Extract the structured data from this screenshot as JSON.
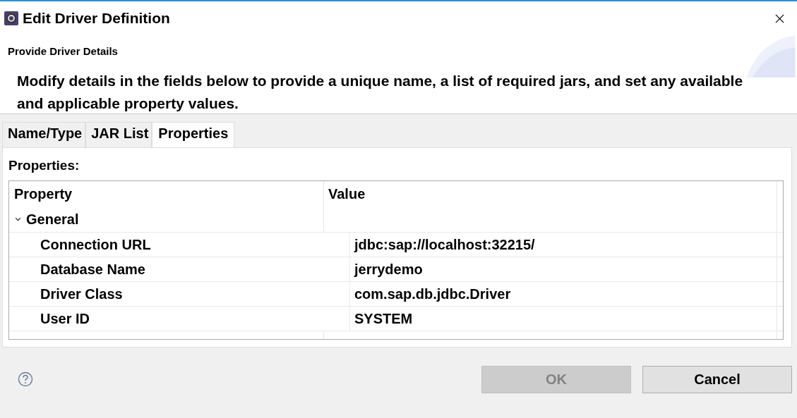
{
  "window": {
    "title": "Edit Driver Definition"
  },
  "header": {
    "title": "Provide Driver Details",
    "description": "Modify details in the fields below to provide a unique name, a list of required jars, and set any available and applicable property values."
  },
  "tabs": [
    {
      "label": "Name/Type",
      "selected": false
    },
    {
      "label": "JAR List",
      "selected": false
    },
    {
      "label": "Properties",
      "selected": true
    }
  ],
  "properties": {
    "label": "Properties:",
    "columns": [
      "Property",
      "Value"
    ],
    "groups": [
      {
        "name": "General",
        "expanded": true,
        "rows": [
          {
            "property": "Connection URL",
            "value": "jdbc:sap://localhost:32215/"
          },
          {
            "property": "Database Name",
            "value": "jerrydemo"
          },
          {
            "property": "Driver Class",
            "value": "com.sap.db.jdbc.Driver"
          },
          {
            "property": "User ID",
            "value": "SYSTEM"
          }
        ]
      }
    ]
  },
  "buttons": [
    {
      "label": "OK",
      "disabled": true
    },
    {
      "label": "Cancel",
      "disabled": false
    }
  ]
}
